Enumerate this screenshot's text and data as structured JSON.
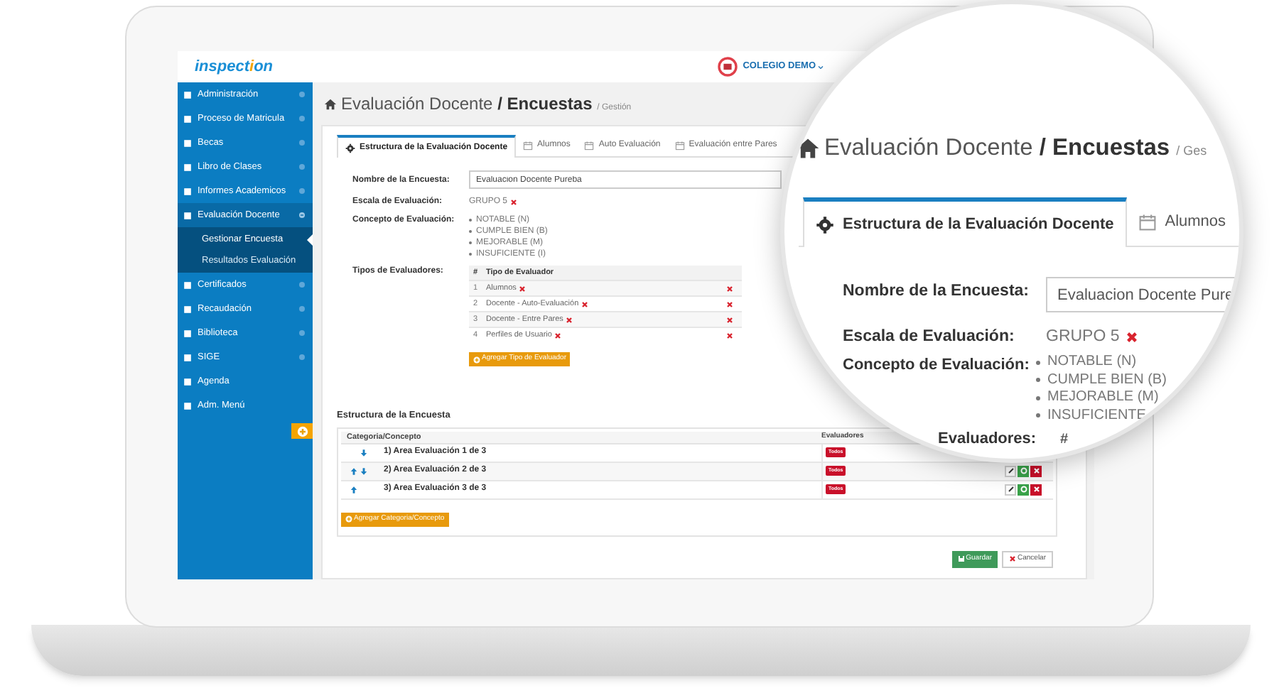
{
  "header": {
    "logo": "inspection",
    "school": "COLEGIO DEMO"
  },
  "sidebar": {
    "items": [
      {
        "label": "Administración",
        "expanded": false
      },
      {
        "label": "Proceso de Matricula",
        "expanded": false
      },
      {
        "label": "Becas",
        "expanded": false
      },
      {
        "label": "Libro de Clases",
        "expanded": false
      },
      {
        "label": "Informes Academicos",
        "expanded": false
      },
      {
        "label": "Evaluación Docente",
        "expanded": true,
        "children": [
          {
            "label": "Gestionar Encuesta",
            "selected": true
          },
          {
            "label": "Resultados Evaluación",
            "selected": false
          }
        ]
      },
      {
        "label": "Certificados",
        "expanded": false
      },
      {
        "label": "Recaudación",
        "expanded": false
      },
      {
        "label": "Biblioteca",
        "expanded": false
      },
      {
        "label": "SIGE",
        "expanded": false
      },
      {
        "label": "Agenda"
      },
      {
        "label": "Adm. Menú"
      }
    ]
  },
  "breadcrumb": {
    "section": "Evaluación Docente",
    "page": "/ Encuestas",
    "sub": "/ Gestión"
  },
  "tabs": [
    {
      "label": "Estructura de la Evaluación Docente",
      "selected": true
    },
    {
      "label": "Alumnos",
      "selected": false
    },
    {
      "label": "Auto Evaluación",
      "selected": false
    },
    {
      "label": "Evaluación entre Pares",
      "selected": false
    }
  ],
  "form": {
    "name_label": "Nombre de la Encuesta:",
    "name_value": "Evaluacion Docente Pureba",
    "scale_label": "Escala de Evaluación:",
    "scale_value": "GRUPO 5",
    "concept_label": "Concepto de Evaluación:",
    "concepts": [
      "NOTABLE (N)",
      "CUMPLE BIEN (B)",
      "MEJORABLE (M)",
      "INSUFICIENTE (I)"
    ],
    "types_label": "Tipos de Evaluadores:"
  },
  "evaluator_types": {
    "columns": [
      "#",
      "Tipo de Evaluador"
    ],
    "rows": [
      {
        "number": "1",
        "name": "Alumnos"
      },
      {
        "number": "2",
        "name": "Docente - Auto-Evaluación"
      },
      {
        "number": "3",
        "name": "Docente - Entre Pares"
      },
      {
        "number": "4",
        "name": "Perfiles de Usuario"
      }
    ]
  },
  "add_type_button": "Agregar Tipo de Evaluador",
  "structure": {
    "title": "Estructura de la Encuesta",
    "columns": [
      "Categoria/Concepto",
      "Evaluadores"
    ],
    "rows": [
      {
        "label": "1) Area Evaluación 1 de 3",
        "up": false,
        "down": true,
        "evaluators": "Todos"
      },
      {
        "label": "2) Area Evaluación 2 de 3",
        "up": true,
        "down": true,
        "evaluators": "Todos",
        "actions": true
      },
      {
        "label": "3) Area Evaluación 3 de 3",
        "up": true,
        "down": false,
        "evaluators": "Todos",
        "actions": true
      }
    ]
  },
  "add_category_button": "Agregar Categoria/Concepto",
  "actions": [
    "Guardar",
    "Cancelar"
  ],
  "magnifier": {
    "breadcrumb": {
      "section": "Evaluación Docente",
      "page": "/ Encuestas",
      "sub": "/ Ges"
    },
    "tabs": [
      {
        "label": "Estructura de la Evaluación Docente",
        "selected": true
      },
      {
        "label": "Alumnos",
        "selected": false
      }
    ],
    "name_label": "Nombre de la Encuesta:",
    "name_value": "Evaluacion Docente Pure",
    "scale_label": "Escala de Evaluación:",
    "scale_value": "GRUPO 5",
    "concept_label": "Concepto de Evaluación:",
    "concepts": [
      "NOTABLE (N)",
      "CUMPLE BIEN (B)",
      "MEJORABLE (M)",
      "INSUFICIENTE"
    ],
    "types_label": "Evaluadores:",
    "column": "#"
  }
}
